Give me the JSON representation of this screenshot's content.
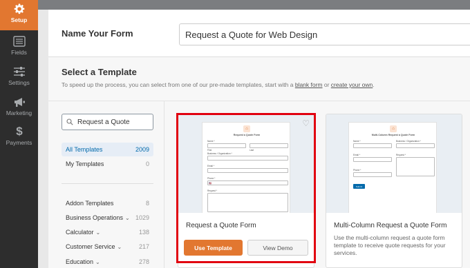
{
  "sidebar": {
    "items": [
      {
        "label": "Setup",
        "icon": "gear-icon",
        "active": true
      },
      {
        "label": "Fields",
        "icon": "fields-icon",
        "active": false
      },
      {
        "label": "Settings",
        "icon": "sliders-icon",
        "active": false
      },
      {
        "label": "Marketing",
        "icon": "megaphone-icon",
        "active": false
      },
      {
        "label": "Payments",
        "icon": "dollar-icon",
        "active": false
      }
    ]
  },
  "name_form": {
    "label": "Name Your Form",
    "value": "Request a Quote for Web Design"
  },
  "templates": {
    "title": "Select a Template",
    "desc_prefix": "To speed up the process, you can select from one of our pre-made templates, start with a ",
    "blank_link": "blank form",
    "desc_mid": " or ",
    "create_link": "create your own",
    "desc_suffix": ".",
    "search_value": "Request a Quote",
    "categories": [
      {
        "label": "All Templates",
        "count": "2009"
      },
      {
        "label": "My Templates",
        "count": "0"
      },
      {
        "label": "Addon Templates",
        "count": "8"
      },
      {
        "label": "Business Operations",
        "count": "1029"
      },
      {
        "label": "Calculator",
        "count": "138"
      },
      {
        "label": "Customer Service",
        "count": "217"
      },
      {
        "label": "Education",
        "count": "278"
      }
    ],
    "cards": [
      {
        "title": "Request a Quote Form",
        "preview": {
          "form_title": "Request a Quote Form",
          "name_label": "Name *",
          "first_label": "First",
          "last_label": "Last",
          "business_label": "Business / Organization *",
          "email_label": "Email *",
          "phone_label": "Phone *",
          "phone_flag": "🇺🇸",
          "request_label": "Request *"
        },
        "use_label": "Use Template",
        "demo_label": "View Demo"
      },
      {
        "title": "Multi-Column Request a Quote Form",
        "description": "Use the multi-column request a quote form template to receive quote requests for your services.",
        "preview": {
          "form_title": "Multi-Column Request a Quote Form",
          "name_label": "Name *",
          "business_label": "Business / Organization *",
          "email_label": "Email *",
          "request_label": "Request *",
          "phone_label": "Phone *",
          "submit_label": "Submit"
        }
      }
    ]
  },
  "colors": {
    "accent": "#e27730",
    "rail": "#2d2d2d",
    "highlight": "#e1000f",
    "link": "#036aab"
  }
}
